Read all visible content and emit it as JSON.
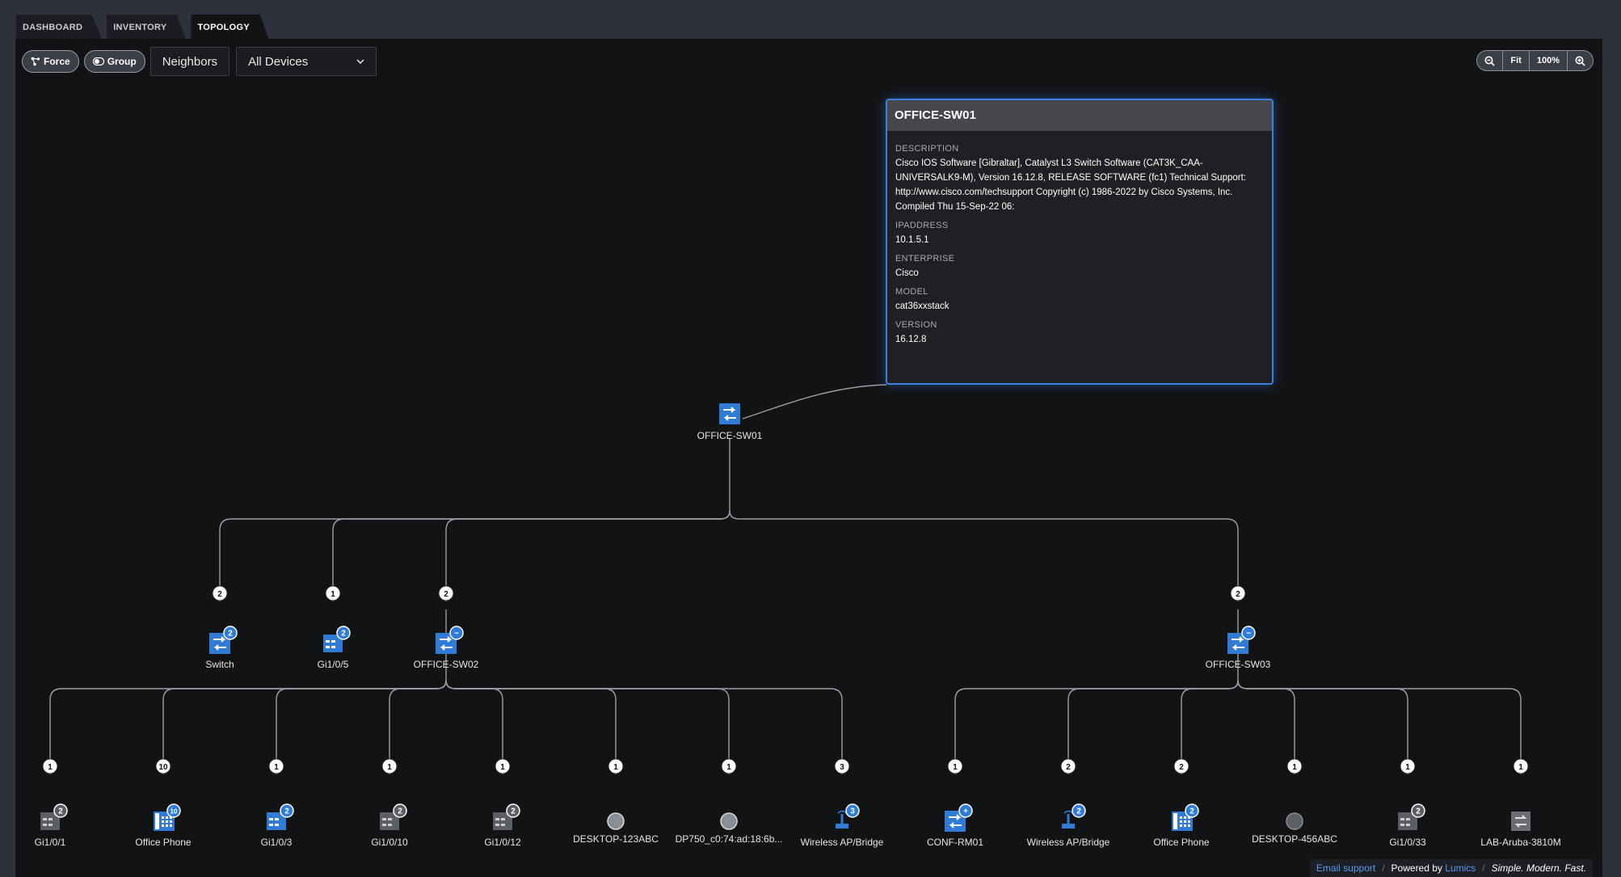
{
  "tabs": [
    {
      "label": "DASHBOARD",
      "active": false
    },
    {
      "label": "INVENTORY",
      "active": false
    },
    {
      "label": "TOPOLOGY",
      "active": true
    }
  ],
  "toolbar": {
    "force_label": "Force",
    "group_label": "Group",
    "neighbors_value": "Neighbors",
    "filter_value": "All Devices"
  },
  "zoom": {
    "fit_label": "Fit",
    "level_label": "100%"
  },
  "tooltip": {
    "title": "OFFICE-SW01",
    "fields": [
      {
        "label": "DESCRIPTION",
        "value": "Cisco IOS Software [Gibraltar], Catalyst L3 Switch Software (CAT3K_CAA-UNIVERSALK9-M), Version 16.12.8, RELEASE SOFTWARE (fc1) Technical Support: http://www.cisco.com/techsupport Copyright (c) 1986-2022 by Cisco Systems, Inc. Compiled Thu 15-Sep-22 06:"
      },
      {
        "label": "IPADDRESS",
        "value": "10.1.5.1"
      },
      {
        "label": "ENTERPRISE",
        "value": "Cisco"
      },
      {
        "label": "MODEL",
        "value": "cat36xxstack"
      },
      {
        "label": "VERSION",
        "value": "16.12.8"
      }
    ]
  },
  "graph": {
    "root": {
      "label": "OFFICE-SW01",
      "icon": "switch-icon"
    },
    "level1": [
      {
        "label": "Switch",
        "icon": "switch-icon",
        "edge_count": "2",
        "badge": "2"
      },
      {
        "label": "Gi1/0/5",
        "icon": "device-icon",
        "edge_count": "1",
        "badge": "2"
      },
      {
        "label": "OFFICE-SW02",
        "icon": "switch-icon",
        "edge_count": "2",
        "badge": "−"
      },
      {
        "label": "OFFICE-SW03",
        "icon": "switch-icon",
        "edge_count": "2",
        "badge": "−"
      }
    ],
    "level2": [
      {
        "label": "Gi1/0/1",
        "icon": "device-icon",
        "edge_count": "1",
        "badge": "2"
      },
      {
        "label": "Office Phone",
        "icon": "phone-icon",
        "edge_count": "10",
        "badge": "10"
      },
      {
        "label": "Gi1/0/3",
        "icon": "device-icon",
        "edge_count": "1",
        "badge": "2"
      },
      {
        "label": "Gi1/0/10",
        "icon": "device-icon",
        "edge_count": "1",
        "badge": "2"
      },
      {
        "label": "Gi1/0/12",
        "icon": "device-icon",
        "edge_count": "1",
        "badge": "2"
      },
      {
        "label": "DESKTOP-123ABC",
        "icon": "desktop-icon",
        "edge_count": "1",
        "badge": ""
      },
      {
        "label": "DP750_c0:74:ad:18:6b...",
        "icon": "desktop-icon",
        "edge_count": "1",
        "badge": ""
      },
      {
        "label": "Wireless AP/Bridge",
        "icon": "wireless-ap-icon",
        "edge_count": "3",
        "badge": "3"
      },
      {
        "label": "CONF-RM01",
        "icon": "switch-icon",
        "edge_count": "1",
        "badge": "+"
      },
      {
        "label": "Wireless AP/Bridge",
        "icon": "wireless-ap-icon",
        "edge_count": "2",
        "badge": "2"
      },
      {
        "label": "Office Phone",
        "icon": "phone-icon",
        "edge_count": "2",
        "badge": "2"
      },
      {
        "label": "DESKTOP-456ABC",
        "icon": "desktop-icon",
        "edge_count": "1",
        "badge": ""
      },
      {
        "label": "Gi1/0/33",
        "icon": "device-icon",
        "edge_count": "1",
        "badge": "2"
      },
      {
        "label": "LAB-Aruba-3810M",
        "icon": "aruba-switch-icon",
        "edge_count": "1",
        "badge": ""
      }
    ]
  },
  "footer": {
    "email_label": "Email support",
    "powered_prefix": "Powered by",
    "brand": "Lumics",
    "tagline": "Simple. Modern. Fast."
  },
  "colors": {
    "accent": "#3b7fe0",
    "switch_blue": "#2f7bd6",
    "panel_bg": "#121315"
  }
}
